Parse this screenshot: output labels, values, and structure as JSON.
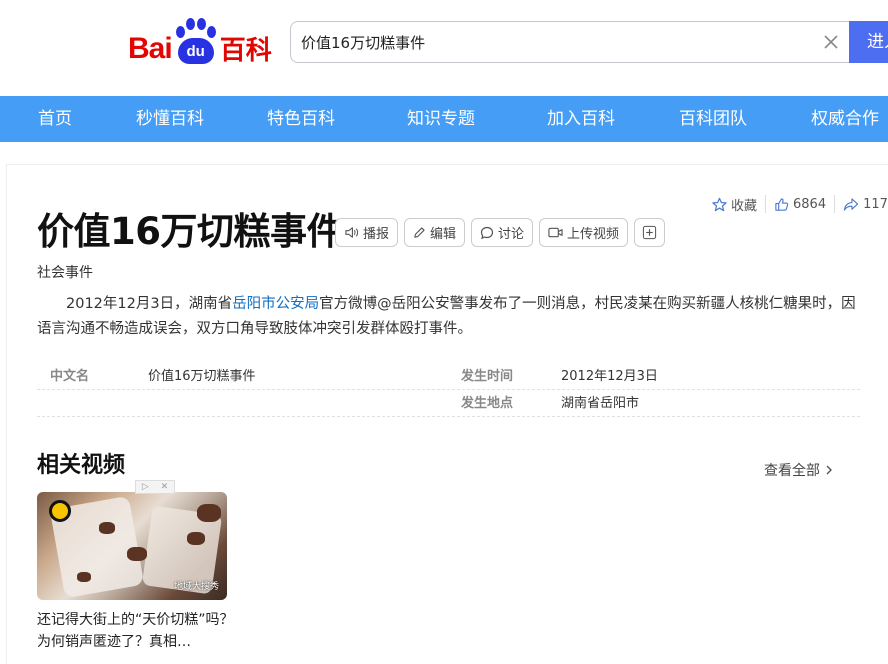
{
  "header": {
    "logo": {
      "left": "Bai",
      "paw": "du",
      "right": "百科"
    },
    "search_value": "价值16万切糕事件",
    "search_button": "进入"
  },
  "nav": {
    "items": [
      "首页",
      "秒懂百科",
      "特色百科",
      "知识专题",
      "加入百科",
      "百科团队",
      "权威合作"
    ]
  },
  "actions": {
    "favorite": "收藏",
    "likes": "6864",
    "shares": "117"
  },
  "entry": {
    "title": "价值16万切糕事件",
    "tools": [
      "播报",
      "编辑",
      "讨论",
      "上传视频"
    ],
    "subtitle": "社会事件",
    "summary": {
      "part1": "2012年12月3日，湖南省",
      "link": "岳阳市公安局",
      "part2": "官方微博@岳阳公安警事发布了一则消息，村民凌某在购买新疆人核桃仁糖果时，因语言沟通不畅造成误会，双方口角导致肢体冲突引发群体殴打事件。"
    },
    "infobox": [
      {
        "key": "中文名",
        "value": "价值16万切糕事件",
        "key2": "发生时间",
        "value2": "2012年12月3日"
      },
      {
        "key": "",
        "value": "",
        "key2": "发生地点",
        "value2": "湖南省岳阳市"
      }
    ]
  },
  "related_videos": {
    "title": "相关视频",
    "see_all": "查看全部",
    "items": [
      {
        "caption": "还记得大街上的“天价切糕”吗？为何销声匿迹了？真相…",
        "thumb_text": "地域大搜秀"
      }
    ]
  },
  "colors": {
    "nav_bg": "#459df5",
    "search_btn": "#4e6ef2",
    "logo_red": "#e10601",
    "logo_blue": "#2932e1",
    "link": "#136ec2"
  }
}
